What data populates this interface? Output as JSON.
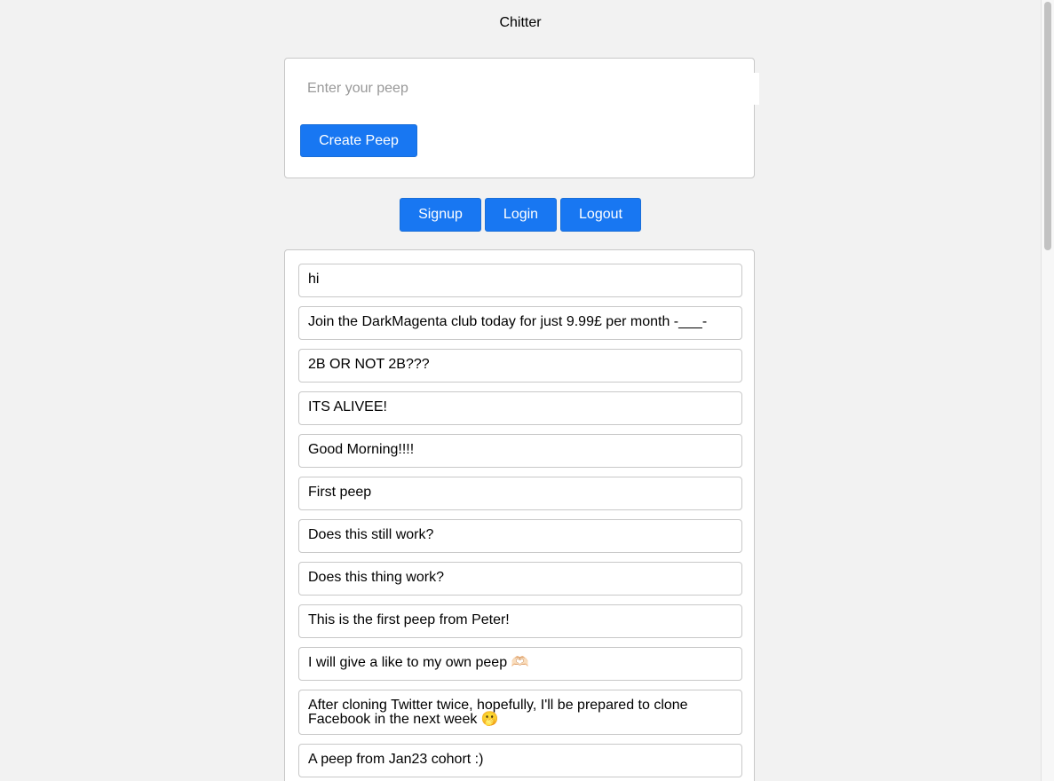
{
  "app": {
    "title": "Chitter"
  },
  "compose": {
    "placeholder": "Enter your peep",
    "value": "",
    "create_label": "Create Peep"
  },
  "nav": {
    "signup_label": "Signup",
    "login_label": "Login",
    "logout_label": "Logout"
  },
  "peeps": [
    "hi",
    "Join the DarkMagenta club today for just 9.99£ per month -___-",
    "2B OR NOT 2B???",
    "ITS ALIVEE!",
    "Good Morning!!!!",
    "First peep",
    "Does this still work?",
    "Does this thing work?",
    "This is the first peep from Peter!",
    "I will give a like to my own peep 🫶🏻",
    "After cloning Twitter twice, hopefully, I'll be prepared to clone Facebook in the next week 🫢",
    "A peep from Jan23 cohort :)"
  ]
}
